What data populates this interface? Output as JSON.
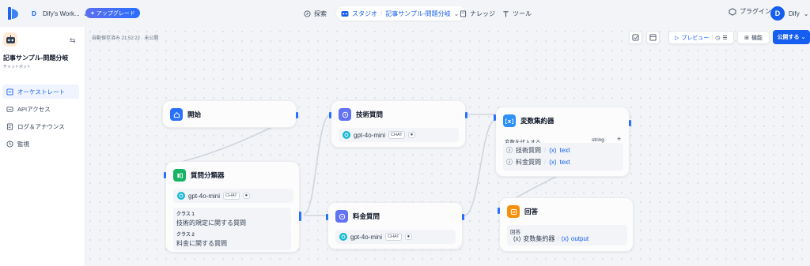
{
  "header": {
    "workspace_initial": "D",
    "workspace_name": "Dify's Work...",
    "upgrade_label": "アップグレード",
    "nav": [
      {
        "label": "探索"
      },
      {
        "label": "スタジオ"
      },
      {
        "label": "記事サンプル-問題分岐"
      },
      {
        "label": "ナレッジ"
      },
      {
        "label": "ツール"
      }
    ],
    "plugins_label": "プラグイン",
    "user_initial": "D",
    "user_name": "Dify"
  },
  "sidebar": {
    "app_name": "記事サンプル-問題分岐",
    "app_type": "チャットボット",
    "items": [
      {
        "label": "オーケストレート",
        "icon": "orchestrate-icon",
        "active": true
      },
      {
        "label": "APIアクセス",
        "icon": "api-icon",
        "active": false
      },
      {
        "label": "ログ＆アナウンス",
        "icon": "log-icon",
        "active": false
      },
      {
        "label": "監視",
        "icon": "monitor-icon",
        "active": false
      }
    ]
  },
  "toolbar": {
    "autosave": "自動保存済み 21:52:22 · 未公開",
    "preview_label": "プレビュー",
    "features_label": "機能",
    "publish_label": "公開する"
  },
  "nodes": {
    "start": {
      "title": "開始"
    },
    "classifier": {
      "title": "質問分類器",
      "model": "gpt-4o-mini",
      "model_tag": "CHAT",
      "classes": [
        {
          "title": "クラス 1",
          "text": "技術的規定に関する質問"
        },
        {
          "title": "クラス 2",
          "text": "料金に関する質問"
        }
      ]
    },
    "tech": {
      "title": "技術質問",
      "model": "gpt-4o-mini",
      "model_tag": "CHAT"
    },
    "price": {
      "title": "料金質問",
      "model": "gpt-4o-mini",
      "model_tag": "CHAT"
    },
    "aggregator": {
      "title": "変数集約器",
      "assign_label": "変数を代入する",
      "type_label": "string",
      "rows": [
        {
          "source": "技術質問",
          "var": "text"
        },
        {
          "source": "料金質問",
          "var": "text"
        }
      ]
    },
    "answer": {
      "title": "回答",
      "answer_label": "回答",
      "source": "変数集約器",
      "var": "output"
    }
  },
  "colors": {
    "accent": "#155eef",
    "start_icon": "#2970ff",
    "classifier_icon": "#16b364",
    "llm_icon": "#6172f3",
    "aggregator_icon": "#2e90fa",
    "answer_icon": "#f79009",
    "edge": "#d0d5dd"
  }
}
